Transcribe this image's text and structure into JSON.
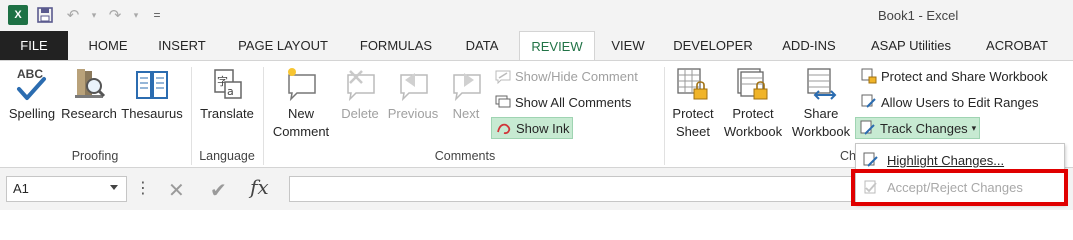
{
  "window": {
    "title": "Book1 - Excel"
  },
  "qat": {
    "logo": "X",
    "save_icon": "save-icon",
    "undo_icon": "undo-icon",
    "redo_icon": "redo-icon",
    "customize": "="
  },
  "tabs": [
    "FILE",
    "HOME",
    "INSERT",
    "PAGE LAYOUT",
    "FORMULAS",
    "DATA",
    "REVIEW",
    "VIEW",
    "DEVELOPER",
    "ADD-INS",
    "ASAP Utilities",
    "ACROBAT"
  ],
  "active_tab": "REVIEW",
  "ribbon": {
    "proofing": {
      "label": "Proofing",
      "spelling": {
        "top": "ABC",
        "label": "Spelling"
      },
      "research": "Research",
      "thesaurus": "Thesaurus"
    },
    "language": {
      "label": "Language",
      "translate": "Translate"
    },
    "comments": {
      "label": "Comments",
      "new_comment_1": "New",
      "new_comment_2": "Comment",
      "delete": "Delete",
      "previous": "Previous",
      "next": "Next",
      "show_hide": "Show/Hide Comment",
      "show_all": "Show All Comments",
      "show_ink": "Show Ink"
    },
    "changes": {
      "label": "Ch",
      "protect_sheet_1": "Protect",
      "protect_sheet_2": "Sheet",
      "protect_workbook_1": "Protect",
      "protect_workbook_2": "Workbook",
      "share_workbook_1": "Share",
      "share_workbook_2": "Workbook",
      "protect_share": "Protect and Share Workbook",
      "allow_users": "Allow Users to Edit Ranges",
      "track_changes": "Track Changes"
    }
  },
  "track_menu": {
    "highlight": "Highlight Changes...",
    "accept_reject": "Accept/Reject Changes"
  },
  "formula_bar": {
    "name_box": "A1",
    "fx": "fx",
    "cancel": "✕",
    "enter": "✔",
    "dots": "⋮"
  },
  "colors": {
    "accent": "#217346",
    "file_tab": "#222222",
    "highlight_on": "#c7ead2",
    "callout": "#e00000"
  }
}
